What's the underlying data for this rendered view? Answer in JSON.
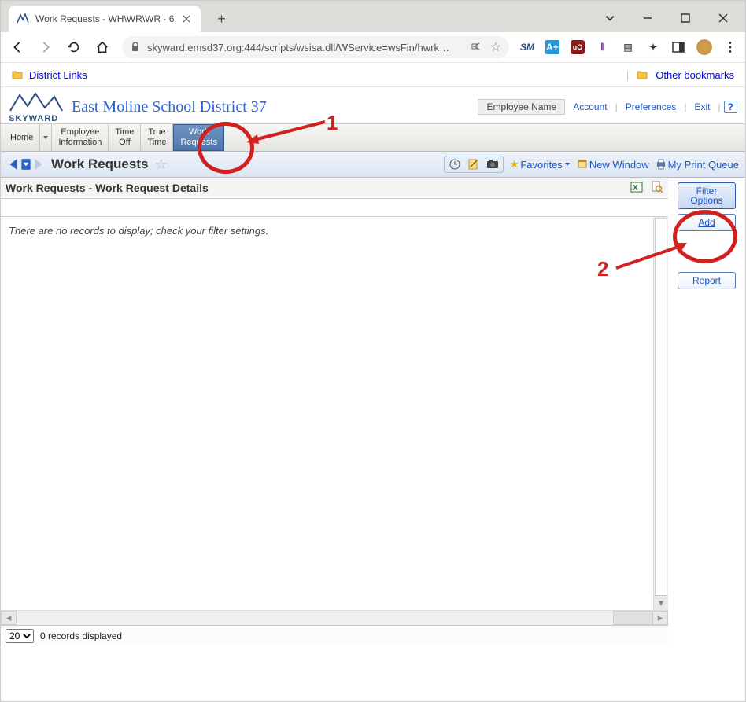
{
  "browser": {
    "tab_title": "Work Requests - WH\\WR\\WR - 6",
    "url": "skyward.emsd37.org:444/scripts/wsisa.dll/WService=wsFin/hwrk…",
    "bookmark_folder": "District Links",
    "other_bookmarks": "Other bookmarks",
    "extensions": {
      "sm": "SM",
      "aplus": "A+",
      "ublock": "uO"
    }
  },
  "skyward": {
    "brand": "SKYWARD",
    "district": "East Moline School District 37",
    "user": {
      "name": "Employee Name",
      "account": "Account",
      "preferences": "Preferences",
      "exit": "Exit",
      "help": "?"
    },
    "nav": [
      "Home",
      "Employee Information",
      "Time Off",
      "True Time",
      "Work Requests"
    ],
    "nav_lines": {
      "employee": [
        "Employee",
        "Information"
      ],
      "timeoff": [
        "Time",
        "Off"
      ],
      "truetime": [
        "True",
        "Time"
      ],
      "work": [
        "Work",
        "Requests"
      ]
    },
    "subnav": {
      "title": "Work Requests",
      "favorites": "Favorites",
      "new_window": "New Window",
      "print_queue": "My Print Queue"
    },
    "grid": {
      "title": "Work Requests - Work Request Details",
      "empty": "There are no records to display; check your filter settings.",
      "page_size": "20",
      "footer": "0 records displayed"
    },
    "rightpanel": {
      "filter_options": [
        "Filter",
        "Options"
      ],
      "add": "Add",
      "report": "Report"
    }
  },
  "annotations": {
    "one": "1",
    "two": "2"
  }
}
